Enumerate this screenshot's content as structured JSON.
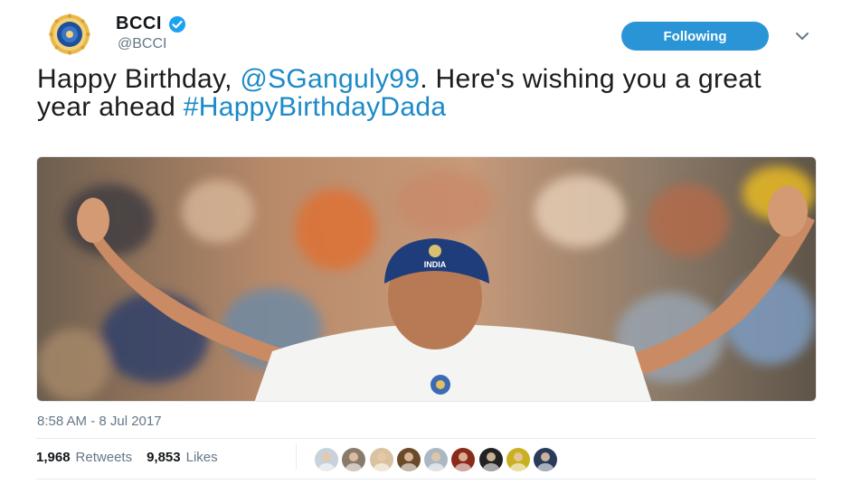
{
  "account": {
    "name": "BCCI",
    "handle": "@BCCI",
    "verified": true,
    "avatar_icon": "bcci-crest-icon"
  },
  "follow_button": {
    "label": "Following"
  },
  "menu_icon": "chevron-down-icon",
  "tweet": {
    "text_prefix": "Happy Birthday, ",
    "mention": "@SGanguly99",
    "text_middle": ". Here's wishing you a great year ahead ",
    "hashtag": "#HappyBirthdayDada"
  },
  "photo": {
    "icon": "cricketer-photo"
  },
  "timestamp": "8:58 AM - 8 Jul 2017",
  "stats": {
    "retweets_count": "1,968",
    "retweets_label": "Retweets",
    "likes_count": "9,853",
    "likes_label": "Likes"
  },
  "likers": [
    {
      "name": "liker-avatar-1",
      "color": "#c7d2da"
    },
    {
      "name": "liker-avatar-2",
      "color": "#8a7a6a"
    },
    {
      "name": "liker-avatar-3",
      "color": "#d9c2a0"
    },
    {
      "name": "liker-avatar-4",
      "color": "#6b4a2a"
    },
    {
      "name": "liker-avatar-5",
      "color": "#aab8c2"
    },
    {
      "name": "liker-avatar-6",
      "color": "#8a2a1a"
    },
    {
      "name": "liker-avatar-7",
      "color": "#222222"
    },
    {
      "name": "liker-avatar-8",
      "color": "#c9b020"
    },
    {
      "name": "liker-avatar-9",
      "color": "#2a3a5a"
    }
  ],
  "colors": {
    "link": "#1b8ac9",
    "follow_button": "#2a95d6",
    "verified": "#1da1f2",
    "muted_text": "#657786"
  }
}
